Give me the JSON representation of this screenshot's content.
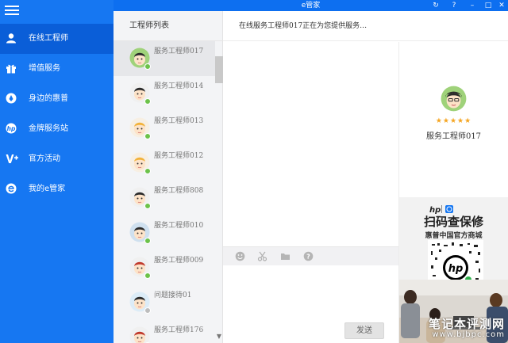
{
  "window": {
    "title": "e管家",
    "controls": [
      "refresh-icon",
      "help-icon",
      "minimize-icon",
      "maximize-icon",
      "close-icon"
    ],
    "accent": "#1677f2"
  },
  "sidebar": {
    "items": [
      {
        "label": "在线工程师",
        "icon": "user-icon",
        "active": true
      },
      {
        "label": "增值服务",
        "icon": "gift-icon"
      },
      {
        "label": "身边的惠普",
        "icon": "location-pin-icon"
      },
      {
        "label": "金牌服务站",
        "icon": "hp-logo-icon"
      },
      {
        "label": "官方活动",
        "icon": "v-plus-icon"
      },
      {
        "label": "我的e管家",
        "icon": "e-logo-icon"
      }
    ]
  },
  "engineer_list": {
    "title": "工程师列表",
    "engineers": [
      {
        "name": "服务工程师017",
        "status": "online",
        "status_color": "#6cc24a"
      },
      {
        "name": "服务工程师014",
        "status": "online",
        "status_color": "#6cc24a"
      },
      {
        "name": "服务工程师013",
        "status": "online",
        "status_color": "#6cc24a"
      },
      {
        "name": "服务工程师012",
        "status": "online",
        "status_color": "#6cc24a"
      },
      {
        "name": "服务工程师808",
        "status": "online",
        "status_color": "#6cc24a"
      },
      {
        "name": "服务工程师010",
        "status": "online",
        "status_color": "#6cc24a"
      },
      {
        "name": "服务工程师009",
        "status": "online",
        "status_color": "#6cc24a"
      },
      {
        "name": "问题接待01",
        "status": "away",
        "status_color": "#bdbdbd"
      },
      {
        "name": "服务工程师176",
        "status": "online",
        "status_color": "#6cc24a"
      }
    ]
  },
  "chat": {
    "status_text": "在线服务工程师017正在为您提供服务…",
    "toolbar": [
      "emoji-icon",
      "scissors-icon",
      "folder-icon",
      "help-circle-icon"
    ],
    "input_value": "",
    "send_label": "发送"
  },
  "profile": {
    "name": "服务工程师017",
    "rating": 5,
    "stars": "★★★★★"
  },
  "ad": {
    "headline": "扫码查保修",
    "subline": "惠普中国官方商城"
  },
  "watermark": {
    "main": "笔记本评测网",
    "url": "www.bjbpc.com"
  }
}
